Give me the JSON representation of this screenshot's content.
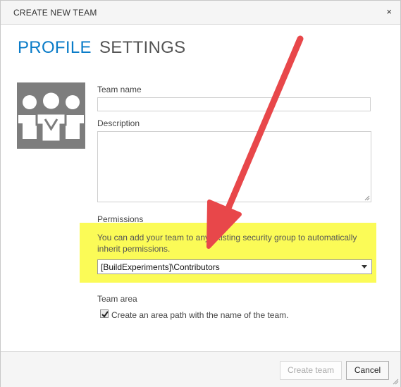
{
  "dialog": {
    "title": "CREATE NEW TEAM",
    "close_glyph": "×"
  },
  "tabs": [
    {
      "label": "PROFILE",
      "active": true
    },
    {
      "label": "SETTINGS",
      "active": false
    }
  ],
  "team_image": {
    "icon": "team-group-icon"
  },
  "form": {
    "team_name": {
      "label": "Team name",
      "value": "",
      "placeholder": ""
    },
    "description": {
      "label": "Description",
      "value": "",
      "placeholder": ""
    },
    "permissions": {
      "label": "Permissions",
      "hint": "You can add your team to any existing security group to automatically inherit permissions.",
      "selected": "[BuildExperiments]\\Contributors"
    },
    "team_area": {
      "label": "Team area",
      "checkbox_label": "Create an area path with the name of the team.",
      "checked": true
    }
  },
  "footer": {
    "create_label": "Create team",
    "cancel_label": "Cancel"
  },
  "colors": {
    "accent": "#0a7cc8",
    "highlight": "#fbfb57",
    "arrow": "#e8474a"
  }
}
